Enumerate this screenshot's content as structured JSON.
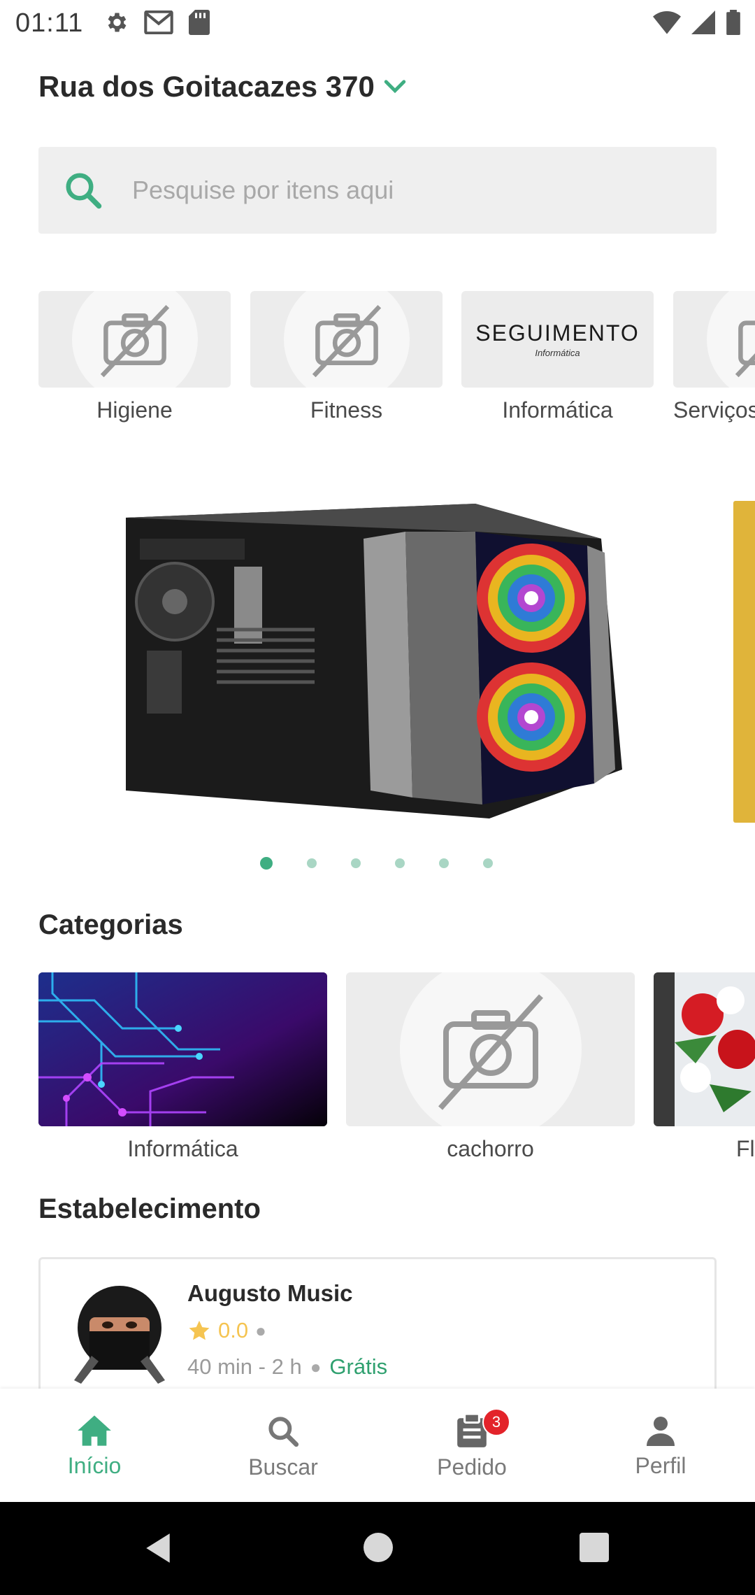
{
  "status_bar": {
    "time": "01:11"
  },
  "header": {
    "address": "Rua dos Goitacazes 370"
  },
  "search": {
    "placeholder": "Pesquise por itens aqui"
  },
  "stores": [
    {
      "label": "Higiene"
    },
    {
      "label": "Fitness"
    },
    {
      "label": "Informática",
      "logo_title": "SEGUIMENTO",
      "logo_sub": "Informática"
    },
    {
      "label": "Serviços"
    }
  ],
  "carousel": {
    "slide_count": 6,
    "active_index": 0
  },
  "categories_section": {
    "title": "Categorias",
    "items": [
      {
        "label": "Informática"
      },
      {
        "label": "cachorro"
      },
      {
        "label": "Fl"
      }
    ]
  },
  "establishments_section": {
    "title": "Estabelecimento",
    "items": [
      {
        "name": "Augusto Music",
        "rating": "0.0",
        "delivery_time": "40 min - 2 h",
        "delivery_fee": "Grátis"
      }
    ]
  },
  "bottom_nav": [
    {
      "label": "Início",
      "icon": "home-icon",
      "active": true
    },
    {
      "label": "Buscar",
      "icon": "search-icon",
      "active": false
    },
    {
      "label": "Pedido",
      "icon": "orders-icon",
      "badge": "3",
      "active": false
    },
    {
      "label": "Perfil",
      "icon": "profile-icon",
      "active": false
    }
  ],
  "colors": {
    "accent": "#3fae82",
    "badge": "#e3232a",
    "rating": "#f5c451",
    "banner_next": "#e0b43a"
  }
}
